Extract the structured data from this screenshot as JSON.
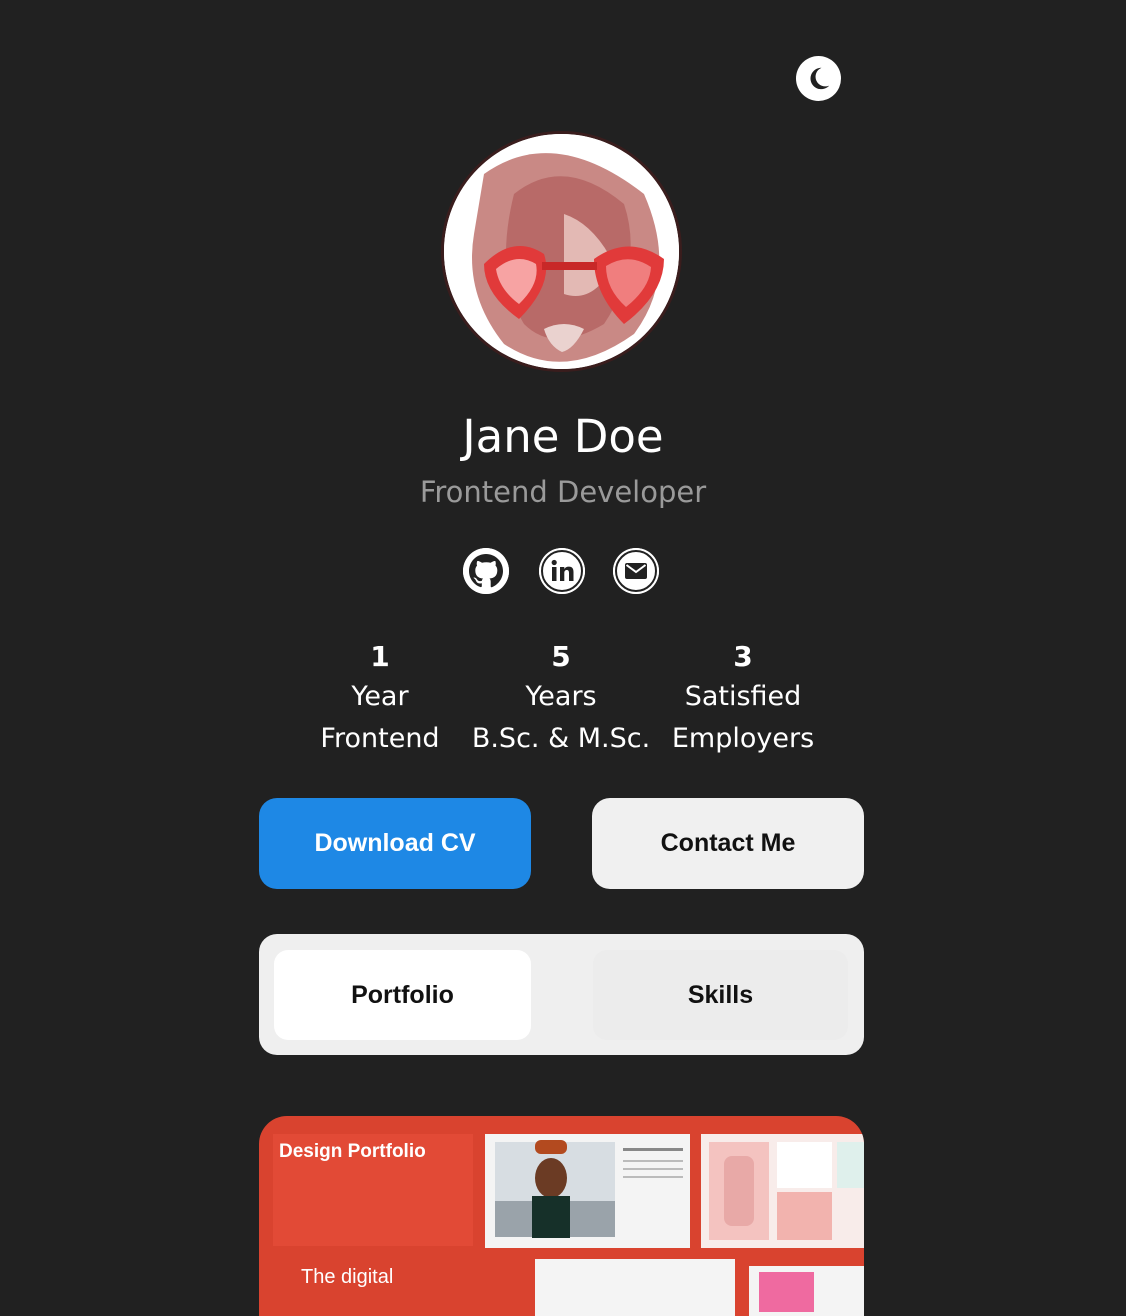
{
  "header": {
    "theme_toggle_icon": "moon-icon"
  },
  "profile": {
    "name": "Jane Doe",
    "role": "Frontend Developer",
    "avatar_icon": "avatar-cat-heart-glasses"
  },
  "socials": [
    {
      "icon": "github-icon"
    },
    {
      "icon": "linkedin-icon"
    },
    {
      "icon": "mail-icon"
    }
  ],
  "stats": [
    {
      "value": "1",
      "line1": "Year",
      "line2": "Frontend"
    },
    {
      "value": "5",
      "line1": "Years",
      "line2": "B.Sc. & M.Sc."
    },
    {
      "value": "3",
      "line1": "Satisfied",
      "line2": "Employers"
    }
  ],
  "actions": {
    "download": "Download CV",
    "contact": "Contact Me"
  },
  "tabs": [
    {
      "label": "Portfolio",
      "active": true
    },
    {
      "label": "Skills",
      "active": false
    }
  ],
  "portfolio_card": {
    "title": "Design Portfolio",
    "subtitle": "The digital"
  },
  "colors": {
    "background": "#212121",
    "primary": "#1e88e5",
    "card": "#d9432f",
    "muted_text": "#9a9a9a"
  }
}
